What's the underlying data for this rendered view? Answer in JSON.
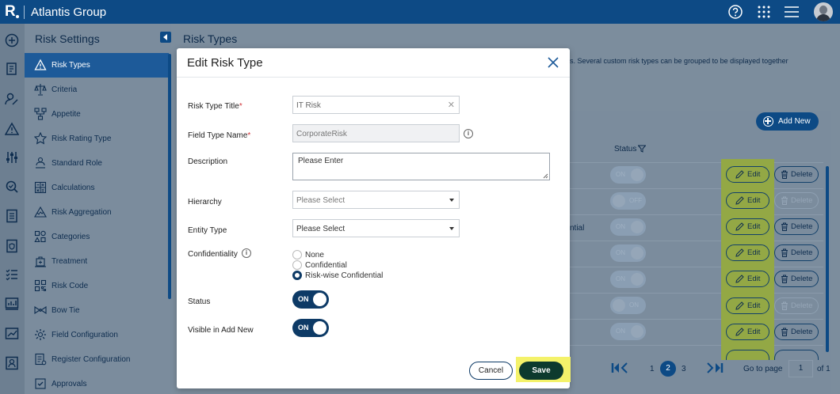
{
  "app": {
    "brand": "Atlantis Group",
    "logo_letter": "R"
  },
  "sidebar": {
    "title": "Risk Settings",
    "items": [
      {
        "label": "Risk Types",
        "icon": "risk-types-icon",
        "active": true
      },
      {
        "label": "Criteria",
        "icon": "criteria-icon"
      },
      {
        "label": "Appetite",
        "icon": "appetite-icon"
      },
      {
        "label": "Risk Rating Type",
        "icon": "star-icon"
      },
      {
        "label": "Standard Role",
        "icon": "role-icon"
      },
      {
        "label": "Calculations",
        "icon": "calculator-icon"
      },
      {
        "label": "Risk Aggregation",
        "icon": "aggregation-icon"
      },
      {
        "label": "Categories",
        "icon": "categories-icon"
      },
      {
        "label": "Treatment",
        "icon": "treatment-icon"
      },
      {
        "label": "Risk Code",
        "icon": "code-icon"
      },
      {
        "label": "Bow Tie",
        "icon": "bow-tie-icon"
      },
      {
        "label": "Field Configuration",
        "icon": "gear-icon"
      },
      {
        "label": "Register Configuration",
        "icon": "register-icon"
      },
      {
        "label": "Approvals",
        "icon": "approvals-icon"
      }
    ]
  },
  "page": {
    "title": "Risk Types",
    "description_fragment": "s. Several custom risk types can be grouped to be displayed together",
    "add_new_label": "Add New",
    "status_header": "Status",
    "row_text": "ntial",
    "rows": [
      {
        "status": "ON",
        "on": true,
        "delete_enabled": true
      },
      {
        "status": "OFF",
        "on": false,
        "delete_enabled": false
      },
      {
        "status": "ON",
        "on": true,
        "delete_enabled": true
      },
      {
        "status": "ON",
        "on": true,
        "delete_enabled": true
      },
      {
        "status": "ON",
        "on": true,
        "delete_enabled": true
      },
      {
        "status": "ON",
        "on": false,
        "delete_enabled": false
      },
      {
        "status": "ON",
        "on": true,
        "delete_enabled": true
      }
    ],
    "edit_label": "Edit",
    "delete_label": "Delete",
    "pagination": {
      "pages": [
        "1",
        "2",
        "3"
      ],
      "current": "2",
      "goto_label": "Go to page",
      "goto_value": "1",
      "of_label": "of 1"
    }
  },
  "modal": {
    "title": "Edit Risk Type",
    "fields": {
      "risk_type_title": {
        "label": "Risk Type Title",
        "value": "IT Risk",
        "required": "*"
      },
      "field_type_name": {
        "label": "Field Type Name",
        "value": "CorporateRisk",
        "required": "*"
      },
      "description": {
        "label": "Description",
        "value": "Please Enter"
      },
      "hierarchy": {
        "label": "Hierarchy",
        "value": "Please Select"
      },
      "entity_type": {
        "label": "Entity Type",
        "value": "Please Select"
      },
      "confidentiality": {
        "label": "Confidentiality",
        "options": [
          "None",
          "Confidential",
          "Risk-wise Confidential"
        ],
        "selected": "Risk-wise Confidential"
      },
      "status": {
        "label": "Status",
        "value": "ON"
      },
      "visible_in_add_new": {
        "label": "Visible in Add New",
        "value": "ON"
      }
    },
    "cancel_label": "Cancel",
    "save_label": "Save"
  },
  "colors": {
    "topbar": "#0d4a85",
    "primary": "#0d3a66",
    "save": "#0d3a2e",
    "highlight_green": "#93a845",
    "highlight_yellow": "#f4f26a",
    "required": "#d13438"
  }
}
